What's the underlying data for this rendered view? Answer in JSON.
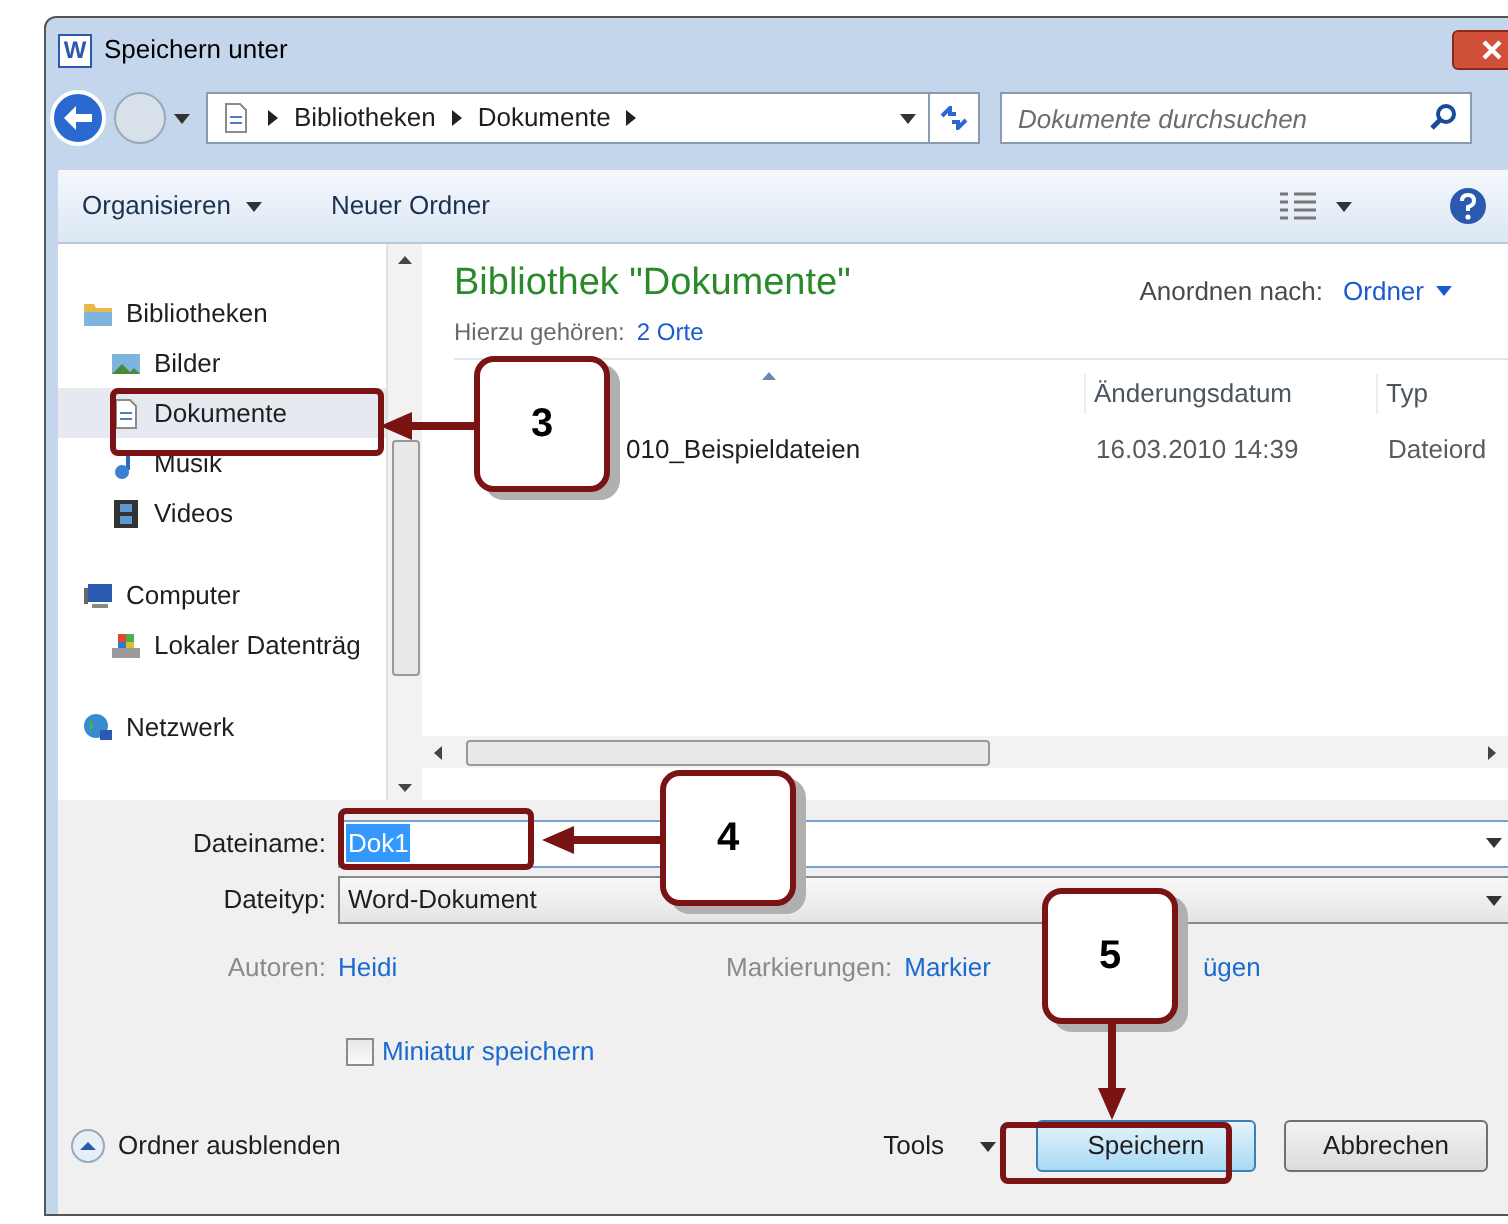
{
  "window": {
    "title": "Speichern unter",
    "app_icon": "W"
  },
  "address": {
    "path": [
      "Bibliotheken",
      "Dokumente"
    ]
  },
  "search": {
    "placeholder": "Dokumente durchsuchen"
  },
  "toolbar": {
    "organize": "Organisieren",
    "new_folder": "Neuer Ordner"
  },
  "nav": [
    {
      "label": "Bibliotheken",
      "kind": "library",
      "selected": false,
      "children": [
        {
          "label": "Bilder",
          "kind": "pictures",
          "selected": false
        },
        {
          "label": "Dokumente",
          "kind": "document",
          "selected": true
        },
        {
          "label": "Musik",
          "kind": "music",
          "selected": false
        },
        {
          "label": "Videos",
          "kind": "video",
          "selected": false
        }
      ]
    },
    {
      "label": "Computer",
      "kind": "computer",
      "selected": false,
      "children": [
        {
          "label": "Lokaler Datenträg",
          "kind": "drive",
          "selected": false
        }
      ]
    },
    {
      "label": "Netzwerk",
      "kind": "network",
      "selected": false
    }
  ],
  "library": {
    "title": "Bibliothek \"Dokumente\"",
    "includes_label": "Hierzu gehören:",
    "includes_link": "2 Orte",
    "arrange_label": "Anordnen nach:",
    "arrange_value": "Ordner"
  },
  "columns": [
    "Änderungsdatum",
    "Typ"
  ],
  "files": [
    {
      "name": "010_Beispieldateien",
      "date": "16.03.2010 14:39",
      "type": "Dateiord"
    }
  ],
  "form": {
    "filename_label": "Dateiname:",
    "filename": "Dok1",
    "filetype_label": "Dateityp:",
    "filetype": "Word-Dokument",
    "authors_label": "Autoren:",
    "authors": "Heidi",
    "tags_label": "Markierungen:",
    "tags_parts": [
      "Markier",
      "ügen"
    ],
    "thumbnail": {
      "label": "Miniatur speichern",
      "checked": false
    }
  },
  "footer": {
    "hide_folders": "Ordner ausblenden",
    "tools": "Tools",
    "save": "Speichern",
    "cancel": "Abbrechen"
  },
  "callouts": [
    {
      "number": "3"
    },
    {
      "number": "4"
    },
    {
      "number": "5"
    }
  ]
}
